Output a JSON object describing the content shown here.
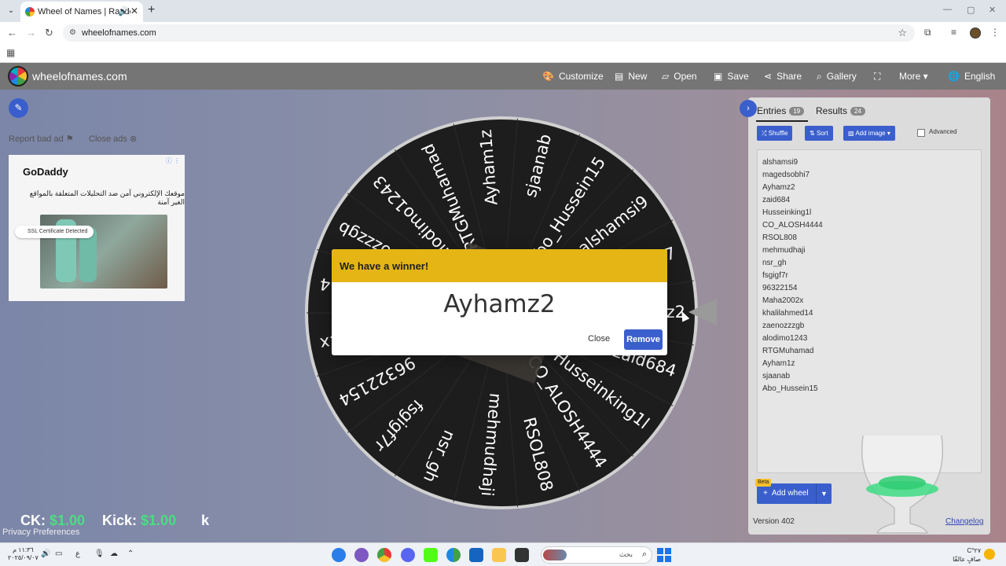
{
  "browser": {
    "tab_title": "Wheel of Names | Random",
    "url": "wheelofnames.com"
  },
  "app": {
    "brand": "wheelofnames.com",
    "menu": [
      "Customize",
      "New",
      "Open",
      "Save",
      "Share",
      "Gallery",
      "More",
      "English"
    ]
  },
  "ads": {
    "report": "Report bad ad",
    "close": "Close ads",
    "advertiser": "GoDaddy",
    "text": "موقعك الإلكتروني آمن ضد التحليلات المتعلقة بالمواقع الغير آمنة",
    "badge": "SSL Certificate Detected"
  },
  "wheel": {
    "entries": [
      "alshamsi9",
      "magedsobhi7",
      "Ayhamz2",
      "zaid684",
      "Husseinking1l",
      "CO_ALOSH4444",
      "RSOL808",
      "mehmudhaji",
      "nsr_gh",
      "fsgigf7r",
      "96322154",
      "Maha2002x",
      "khalilahmed14",
      "zaenozzzgb",
      "alodimo1243",
      "RTGMuhamad",
      "Ayham1z",
      "sjaanab",
      "Abo_Hussein15"
    ],
    "winner": "Ayhamz2",
    "colors": {
      "face": "#1d1d1d",
      "rim": "#d0d0d0",
      "hub": "#3d3a35",
      "text": "#ffffff"
    }
  },
  "panel": {
    "tab_entries": "Entries",
    "entries_count": "19",
    "tab_results": "Results",
    "results_count": "24",
    "shuffle": "Shuffle",
    "sort": "Sort",
    "add_image": "Add image",
    "advanced": "Advanced",
    "add_wheel": "Add wheel",
    "beta": "Beta",
    "version": "Version 402",
    "changelog": "Changelog"
  },
  "modal": {
    "title": "We have a winner!",
    "winner": "Ayhamz2",
    "close": "Close",
    "remove": "Remove"
  },
  "overlay": {
    "ticker_a": "CK:",
    "ticker_a_val": "$1.00",
    "ticker_b": "Kick:",
    "ticker_b_val": "$1.00",
    "ticker_c": "k",
    "privacy": "Privacy Preferences"
  },
  "taskbar": {
    "time": "١١:٣٦ م",
    "date": "٢٠٢٥/٠٩/٠٧",
    "search_placeholder": "بحث",
    "temp": "٢٧°C",
    "weather": "صافٍ عالقًا",
    "lang": "ع"
  },
  "colors": {
    "accent": "#3a5fcd",
    "modal_header": "#e5b516"
  }
}
